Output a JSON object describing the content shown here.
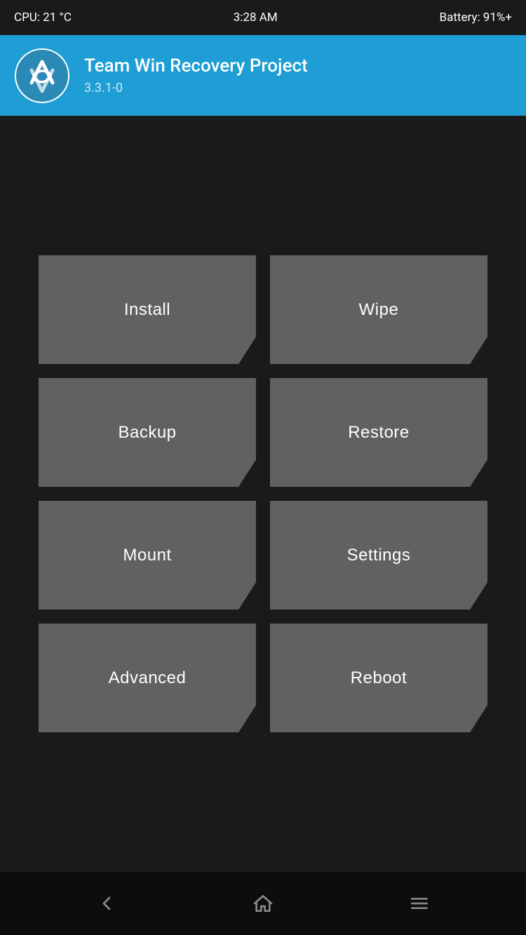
{
  "status_bar": {
    "cpu": "CPU: 21 °C",
    "time": "3:28 AM",
    "battery": "Battery: 91%+"
  },
  "header": {
    "title": "Team Win Recovery Project",
    "version": "3.3.1-0"
  },
  "buttons": [
    [
      {
        "id": "install",
        "label": "Install"
      },
      {
        "id": "wipe",
        "label": "Wipe"
      }
    ],
    [
      {
        "id": "backup",
        "label": "Backup"
      },
      {
        "id": "restore",
        "label": "Restore"
      }
    ],
    [
      {
        "id": "mount",
        "label": "Mount"
      },
      {
        "id": "settings",
        "label": "Settings"
      }
    ],
    [
      {
        "id": "advanced",
        "label": "Advanced"
      },
      {
        "id": "reboot",
        "label": "Reboot"
      }
    ]
  ],
  "nav": {
    "back_label": "back",
    "home_label": "home",
    "menu_label": "menu"
  }
}
